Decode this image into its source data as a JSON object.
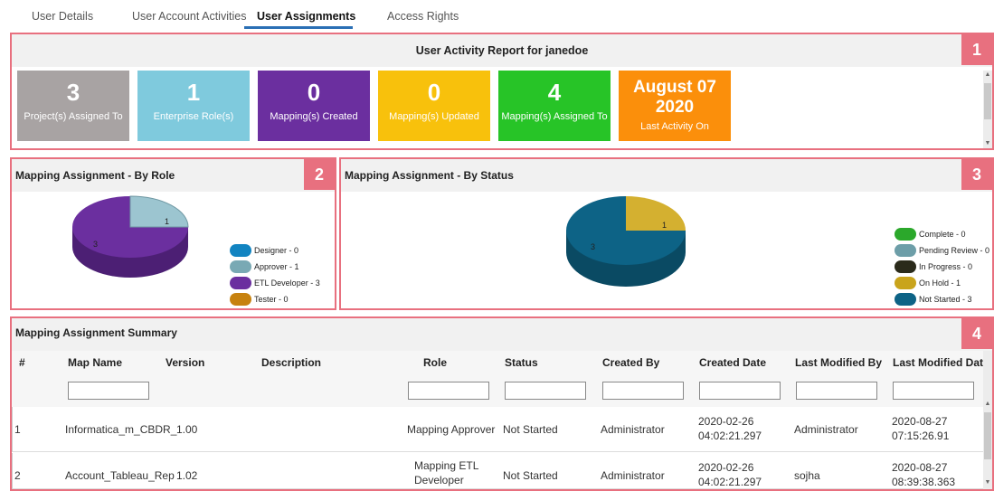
{
  "tabs": [
    {
      "label": "User Details"
    },
    {
      "label": "User Account Activities"
    },
    {
      "label": "User Assignments"
    },
    {
      "label": "Access Rights"
    }
  ],
  "activity": {
    "title": "User Activity Report for janedoe",
    "badge": "1",
    "tiles": [
      {
        "value": "3",
        "caption": "Project(s) Assigned To",
        "color": "#a8a3a3"
      },
      {
        "value": "1",
        "caption": "Enterprise Role(s)",
        "color": "#7fcadd"
      },
      {
        "value": "0",
        "caption": "Mapping(s) Created",
        "color": "#6b2f9f"
      },
      {
        "value": "0",
        "caption": "Mapping(s) Updated",
        "color": "#f8c10c"
      },
      {
        "value": "4",
        "caption": "Mapping(s) Assigned To",
        "color": "#27c427"
      },
      {
        "value": "August 07 2020",
        "caption": "Last Activity On",
        "color": "#fb8f0b"
      }
    ]
  },
  "by_role": {
    "title": "Mapping Assignment - By Role",
    "badge": "2",
    "slice_labels": {
      "small": "1",
      "large": "3"
    },
    "legend": [
      {
        "label": "Designer - 0",
        "color": "#1284c1"
      },
      {
        "label": "Approver - 1",
        "color": "#79a9b4"
      },
      {
        "label": "ETL Developer - 3",
        "color": "#6b2f9f"
      },
      {
        "label": "Tester - 0",
        "color": "#c7820f"
      }
    ],
    "values": [
      0,
      1,
      3,
      0
    ]
  },
  "by_status": {
    "title": "Mapping Assignment - By Status",
    "badge": "3",
    "slice_labels": {
      "small": "1",
      "large": "3"
    },
    "legend": [
      {
        "label": "Complete - 0",
        "color": "#2ba82b"
      },
      {
        "label": "Pending Review - 0",
        "color": "#6d9ea8"
      },
      {
        "label": "In Progress - 0",
        "color": "#2a2a1a"
      },
      {
        "label": "On Hold - 1",
        "color": "#c9a41c"
      },
      {
        "label": "Not Started - 3",
        "color": "#0d6386"
      }
    ],
    "values": [
      0,
      0,
      0,
      1,
      3
    ]
  },
  "summary": {
    "title": "Mapping Assignment Summary",
    "badge": "4",
    "columns": [
      "#",
      "Map Name",
      "Version",
      "Description",
      "Role",
      "Status",
      "Created By",
      "Created Date",
      "Last Modified By",
      "Last Modified Date"
    ],
    "rows": [
      {
        "num": "1",
        "map_name": "Informatica_m_CBDR_",
        "version": "1.00",
        "description": "",
        "role_line1": "Mapping Approver",
        "role_line2": "",
        "status": "Not Started",
        "created_by": "Administrator",
        "created_date_line1": "2020-02-26",
        "created_date_line2": "04:02:21.297",
        "last_modified_by": "Administrator",
        "last_modified_line1": "2020-08-27",
        "last_modified_line2": "07:15:26.91"
      },
      {
        "num": "2",
        "map_name": "Account_Tableau_Rep",
        "version": "1.02",
        "description": "",
        "role_line1": "Mapping ETL",
        "role_line2": "Developer",
        "status": "Not Started",
        "created_by": "Administrator",
        "created_date_line1": "2020-02-26",
        "created_date_line2": "04:02:21.297",
        "last_modified_by": "sojha",
        "last_modified_line1": "2020-08-27",
        "last_modified_line2": "08:39:38.363"
      }
    ]
  }
}
